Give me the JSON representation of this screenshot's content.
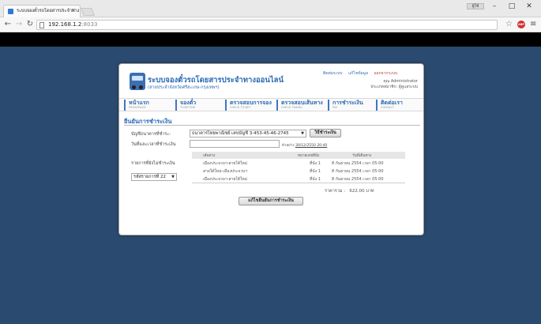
{
  "browser": {
    "tab_title": "ระบบจองตั๋วรถโดยสารประจำทาง",
    "url_host": "192.168.1.2",
    "url_port": ":8033",
    "user_button": "ผู้ใช้"
  },
  "site": {
    "title": "ระบบจองตั๋วรถโดยสารประจำทางออนไลน์",
    "subtitle": "(สายประจำจังหวัดศรีสะเกษ-กรุงเทพฯ)",
    "links": {
      "contact": "ติดต่อระบบ",
      "edit_profile": "แก้ไขข้อมูล",
      "logout": "ออกจากระบบ"
    },
    "user_line": "คุณ Administrator",
    "user_role": "ประเภทสมาชิก: ผู้ดูแลระบบ"
  },
  "nav": [
    {
      "label": "หน้าแรก",
      "sub": "FRONTPAGE"
    },
    {
      "label": "จองตั๋ว",
      "sub": "TICKETING"
    },
    {
      "label": "ตรวจสอบการจอง",
      "sub": "CHECK TICKET"
    },
    {
      "label": "ตรวจสอบเส้นทาง",
      "sub": "CHECK TRAVEL"
    },
    {
      "label": "การชำระเงิน",
      "sub": "PAY"
    },
    {
      "label": "ติดต่อเรา",
      "sub": "CONTACT"
    }
  ],
  "form": {
    "title": "ยืนยันการชำระเงิน",
    "account_label": "บัญชีธนาคารที่ชำระ:",
    "account_value": "ธนาคารไทยพาณิชย์ เลขบัญชี 3-453-45-46-2745",
    "howto_button": "วิธีชำระเงิน",
    "date_label": "วันที่และเวลาที่ชำระเงิน",
    "date_value": "",
    "date_hint_prefix": "ตัวอย่าง",
    "date_hint_example": "30/12/2550 20:40",
    "pending_label": "รายการที่ยังไม่ชำระเงิน",
    "pending_value": "รหัสรายการที่ 22",
    "columns": {
      "route": "เส้นทาง",
      "seat": "หมายเลขที่นั่ง",
      "date": "วันที่เดินทาง"
    },
    "rows": [
      {
        "route": "เมืองประจวบฯ-สายใต้ใหม่",
        "seat": "ที่นั่ง 1",
        "date": "8 กันยายน 2554 เวลา 05:00"
      },
      {
        "route": "สายใต้ใหม่-เมืองประจวบฯ",
        "seat": "ที่นั่ง 1",
        "date": "8 กันยายน 2554 เวลา 05:00"
      },
      {
        "route": "เมืองประจวบฯ-สายใต้ใหม่",
        "seat": "ที่นั่ง 1",
        "date": "8 กันยายน 2554 เวลา 05:00"
      }
    ],
    "total_label": "ราคารวม :",
    "total_value": "622.00",
    "total_unit": "บาท",
    "submit_button": "แก้ไขยืนยันการชำระเงิน"
  },
  "colors": {
    "page_bg": "#2b4a6f",
    "accent": "#2b6ab5",
    "logout": "#c0392b"
  }
}
